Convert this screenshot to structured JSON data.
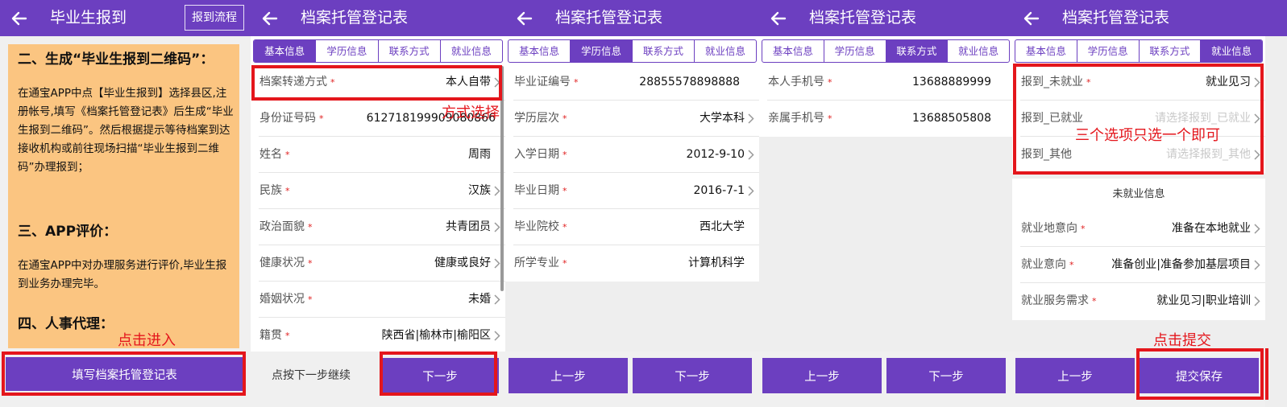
{
  "colors": {
    "primary": "#6c3fc0",
    "guide_bg": "#fbc581",
    "annotation": "#e4161c",
    "required": "#e02020"
  },
  "icons": {
    "back": "back-arrow-icon",
    "row_arrow": "chevron-right-icon"
  },
  "screen1": {
    "title": "毕业生报到",
    "header_button": "报到流程",
    "guide": {
      "heading2": "二、生成“毕业生报到二维码”：",
      "para2": "在通宝APP中点【毕业生报到】选择县区,注册帐号,填写《档案托管登记表》后生成“毕业生报到二维码”。然后根据提示等待档案到达接收机构或前往现场扫描“毕业生报到二维码”办理报到；",
      "heading3": "三、APP评价：",
      "para3": "在通宝APP中对办理服务进行评价,毕业生报到业务办理完毕。",
      "heading4": "四、人事代理："
    },
    "annotation": "点击进入",
    "button": "填写档案托管登记表"
  },
  "form_title": "档案托管登记表",
  "tabs": [
    "基本信息",
    "学历信息",
    "联系方式",
    "就业信息"
  ],
  "required_mark": "*",
  "screen2": {
    "rows": [
      {
        "label": "档案转递方式",
        "value": "本人自带"
      },
      {
        "label": "身份证号码",
        "value": "612718199909080866"
      },
      {
        "label": "姓名",
        "value": "周雨"
      },
      {
        "label": "民族",
        "value": "汉族"
      },
      {
        "label": "政治面貌",
        "value": "共青团员"
      },
      {
        "label": "健康状况",
        "value": "健康或良好"
      },
      {
        "label": "婚姻状况",
        "value": "未婚"
      },
      {
        "label": "籍贯",
        "value": "陕西省|榆林市|榆阳区"
      }
    ],
    "annotation": "方式选择",
    "hint": "点按下一步继续",
    "next": "下一步"
  },
  "screen3": {
    "rows": [
      {
        "label": "毕业证编号",
        "value": "28855578898888"
      },
      {
        "label": "学历层次",
        "value": "大学本科"
      },
      {
        "label": "入学日期",
        "value": "2012-9-10"
      },
      {
        "label": "毕业日期",
        "value": "2016-7-1"
      },
      {
        "label": "毕业院校",
        "value": "西北大学"
      },
      {
        "label": "所学专业",
        "value": "计算机科学"
      }
    ],
    "prev": "上一步",
    "next": "下一步"
  },
  "screen4": {
    "rows": [
      {
        "label": "本人手机号",
        "value": "13688889999"
      },
      {
        "label": "亲属手机号",
        "value": "13688505808"
      }
    ],
    "prev": "上一步",
    "next": "下一步"
  },
  "screen5": {
    "rows_top": [
      {
        "label": "报到_未就业",
        "value": "就业见习"
      },
      {
        "label": "报到_已就业",
        "value": "请选择报到_已就业"
      },
      {
        "label": "报到_其他",
        "value": "请选择报到_其他"
      }
    ],
    "annotation_choice": "三个选项只选一个即可",
    "section_title": "未就业信息",
    "rows_bottom": [
      {
        "label": "就业地意向",
        "value": "准备在本地就业"
      },
      {
        "label": "就业意向",
        "value": "准备创业|准备参加基层项目"
      },
      {
        "label": "就业服务需求",
        "value": "就业见习|职业培训"
      }
    ],
    "annotation_submit": "点击提交",
    "prev": "上一步",
    "submit": "提交保存"
  }
}
